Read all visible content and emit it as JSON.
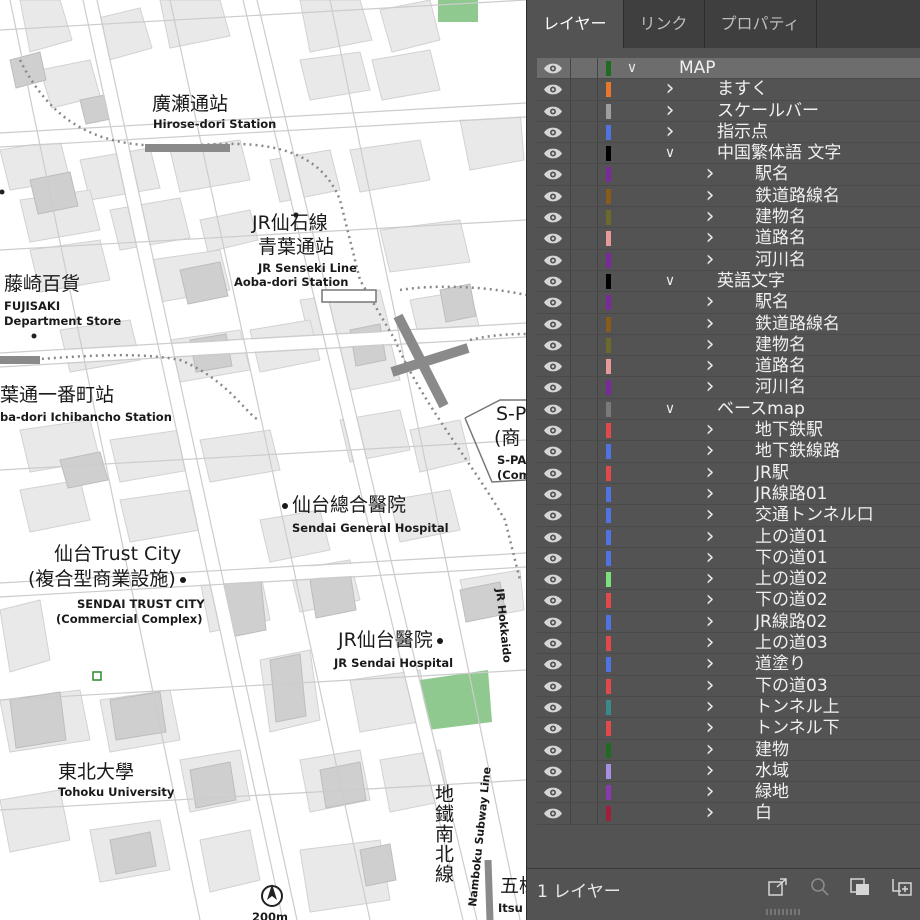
{
  "map": {
    "labels": {
      "hirose_ja": "廣瀬通站",
      "hirose_en": "Hirose-dori Station",
      "senseki_ja1": "JR仙石線",
      "senseki_ja2": "青葉通站",
      "senseki_en1": "JR Senseki Line",
      "senseki_en2": "Aoba-dori Station",
      "fujisaki_ja": "藤崎百貨",
      "fujisaki_en1": "FUJISAKI",
      "fujisaki_en2": "Department Store",
      "ichibancho_ja": "葉通一番町站",
      "ichibancho_en": "ba-dori Ichibancho Station",
      "spal_ja1": "S-P",
      "spal_ja2": "(商",
      "spal_en1": "S-PA",
      "spal_en2": "(Com",
      "general_hosp_ja": "仙台總合醫院",
      "general_hosp_en": "Sendai General Hospital",
      "trust_ja1": "仙台Trust City",
      "trust_ja2": "(複合型商業設施)",
      "trust_en1": "SENDAI TRUST CITY",
      "trust_en2": "(Commercial Complex)",
      "jr_hosp_ja": "JR仙台醫院",
      "jr_hosp_en": "JR Sendai Hospital",
      "tohoku_ja": "東北大學",
      "tohoku_en": "Tohoku University",
      "subway_ja": "地鐵南北線",
      "subway_en": "Namboku Subway Line",
      "hokkaido_en": "JR Hokkaido",
      "gojo_ja": "五様",
      "itsu_en": "Itsu",
      "north": "N",
      "scale": "200m"
    }
  },
  "panel": {
    "tabs": [
      "レイヤー",
      "リンク",
      "プロパティ"
    ],
    "footer_count": "1 レイヤー",
    "layers": [
      {
        "name": "MAP",
        "level": 0,
        "expanded": true,
        "color": "#1f6b1f",
        "selected": true
      },
      {
        "name": "ますく",
        "level": 1,
        "expanded": false,
        "color": "#e8772b"
      },
      {
        "name": "スケールバー",
        "level": 1,
        "expanded": false,
        "color": "#9e9e9e"
      },
      {
        "name": "指示点",
        "level": 1,
        "expanded": false,
        "color": "#4f73e0"
      },
      {
        "name": "中国繁体語 文字",
        "level": 1,
        "expanded": true,
        "color": "#000000"
      },
      {
        "name": "駅名",
        "level": 2,
        "expanded": false,
        "color": "#7a2a9a"
      },
      {
        "name": "鉄道路線名",
        "level": 2,
        "expanded": false,
        "color": "#8a5a1a"
      },
      {
        "name": "建物名",
        "level": 2,
        "expanded": false,
        "color": "#6a6a2a"
      },
      {
        "name": "道路名",
        "level": 2,
        "expanded": false,
        "color": "#e89a9a"
      },
      {
        "name": "河川名",
        "level": 2,
        "expanded": false,
        "color": "#7a2a9a"
      },
      {
        "name": "英語文字",
        "level": 1,
        "expanded": true,
        "color": "#000000"
      },
      {
        "name": "駅名",
        "level": 2,
        "expanded": false,
        "color": "#7a2a9a"
      },
      {
        "name": "鉄道路線名",
        "level": 2,
        "expanded": false,
        "color": "#8a5a1a"
      },
      {
        "name": "建物名",
        "level": 2,
        "expanded": false,
        "color": "#6a6a2a"
      },
      {
        "name": "道路名",
        "level": 2,
        "expanded": false,
        "color": "#e89a9a"
      },
      {
        "name": "河川名",
        "level": 2,
        "expanded": false,
        "color": "#7a2a9a"
      },
      {
        "name": "ベースmap",
        "level": 1,
        "expanded": true,
        "color": "#7a7a7a"
      },
      {
        "name": "地下鉄駅",
        "level": 2,
        "expanded": false,
        "color": "#e04a4a"
      },
      {
        "name": "地下鉄線路",
        "level": 2,
        "expanded": false,
        "color": "#4f73e0"
      },
      {
        "name": "JR駅",
        "level": 2,
        "expanded": false,
        "color": "#e04a4a"
      },
      {
        "name": "JR線路01",
        "level": 2,
        "expanded": false,
        "color": "#4f73e0"
      },
      {
        "name": "交通トンネル口",
        "level": 2,
        "expanded": false,
        "color": "#4f73e0"
      },
      {
        "name": "上の道01",
        "level": 2,
        "expanded": false,
        "color": "#4f73e0"
      },
      {
        "name": "下の道01",
        "level": 2,
        "expanded": false,
        "color": "#4f73e0"
      },
      {
        "name": "上の道02",
        "level": 2,
        "expanded": false,
        "color": "#7ce07c"
      },
      {
        "name": "下の道02",
        "level": 2,
        "expanded": false,
        "color": "#e04a4a"
      },
      {
        "name": "JR線路02",
        "level": 2,
        "expanded": false,
        "color": "#4f73e0"
      },
      {
        "name": "上の道03",
        "level": 2,
        "expanded": false,
        "color": "#e04a4a"
      },
      {
        "name": "道塗り",
        "level": 2,
        "expanded": false,
        "color": "#4f73e0"
      },
      {
        "name": "下の道03",
        "level": 2,
        "expanded": false,
        "color": "#e04a4a"
      },
      {
        "name": "トンネル上",
        "level": 2,
        "expanded": false,
        "color": "#3a8a8a"
      },
      {
        "name": "トンネル下",
        "level": 2,
        "expanded": false,
        "color": "#e04a4a"
      },
      {
        "name": "建物",
        "level": 2,
        "expanded": false,
        "color": "#1f6b1f"
      },
      {
        "name": "水域",
        "level": 2,
        "expanded": false,
        "color": "#a890e0"
      },
      {
        "name": "緑地",
        "level": 2,
        "expanded": false,
        "color": "#8a3ab0"
      },
      {
        "name": "白",
        "level": 2,
        "expanded": false,
        "color": "#a01f3a"
      }
    ]
  }
}
